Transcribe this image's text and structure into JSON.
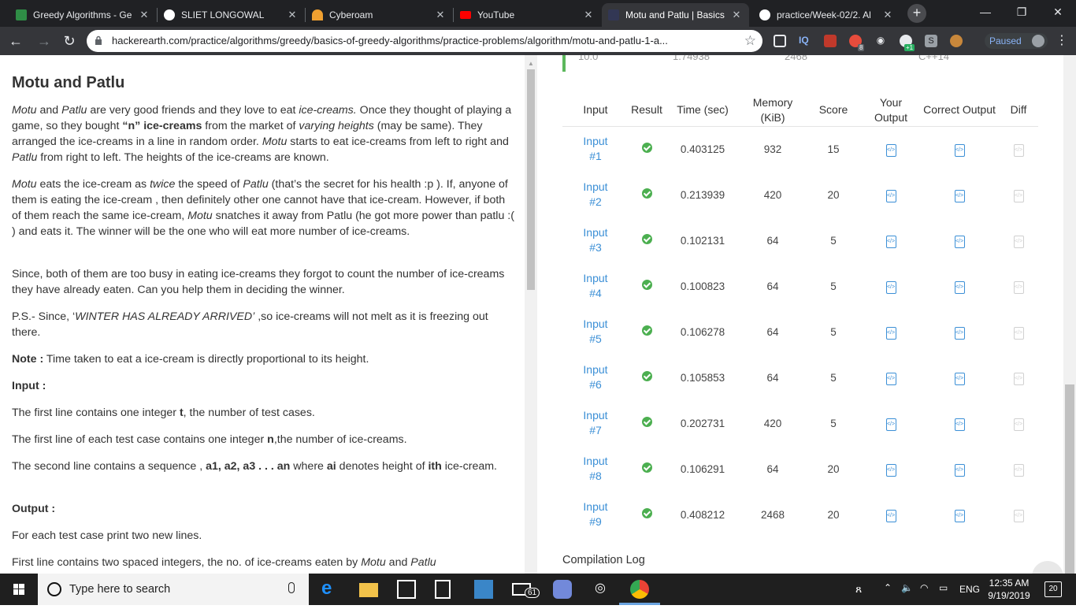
{
  "browser": {
    "tabs": [
      {
        "title": "Greedy Algorithms - Ge",
        "active": false
      },
      {
        "title": "SLIET LONGOWAL",
        "active": false
      },
      {
        "title": "Cyberoam",
        "active": false
      },
      {
        "title": "YouTube",
        "active": false
      },
      {
        "title": "Motu and Patlu | Basics",
        "active": true
      },
      {
        "title": "practice/Week-02/2. Al",
        "active": false
      }
    ],
    "url": "hackerearth.com/practice/algorithms/greedy/basics-of-greedy-algorithms/practice-problems/algorithm/motu-and-patlu-1-a...",
    "profile_status": "Paused",
    "extension_badges": {
      "red_badge": "8",
      "green_badge": "+1"
    }
  },
  "problem": {
    "title": "Motu and Patlu",
    "paragraphs": {
      "p1": [
        "Motu",
        " and ",
        "Patlu",
        " are very good friends and they love to eat ",
        "ice-creams.",
        " Once they thought of playing a game, so they bought ",
        "“n” ice-creams",
        " from the market of ",
        "varying heights",
        " (may be same). They arranged the ice-creams in a line in random order. ",
        "Motu",
        " starts to eat ice-creams from left to right and ",
        "Patlu",
        " from right to left. The heights of the ice-creams are known."
      ],
      "p2": [
        "Motu",
        " eats the ice-cream as ",
        "twice",
        " the speed of ",
        "Patlu",
        " (that’s the secret for his health :p ). If, anyone of them is eating the ice-cream , then definitely other one cannot have that ice-cream. However, if both of them reach the same ice-cream, ",
        "Motu",
        " snatches it away from Patlu (he got more power than patlu :( ) and eats it. The winner will be the one who will eat more number of ice-creams."
      ],
      "p3": "Since, both of them are too busy in eating ice-creams they forgot to count the number of ice-creams they have already eaten. Can you help them in deciding the winner.",
      "p4": [
        "P.S.- Since, ‘",
        "WINTER HAS ALREADY ARRIVED’",
        " ,so ice-creams will not melt as it is freezing out there."
      ],
      "note_label": "Note :",
      "note_text": " Time taken to eat a ice-cream is directly proportional to its height.",
      "input_heading": "Input :",
      "input1": [
        "The first line contains one integer ",
        "t",
        ", the number of test cases."
      ],
      "input2": [
        "The first line of each test case contains one integer ",
        "n",
        ",the number of ice-creams."
      ],
      "input3": [
        "The second line contains a sequence , ",
        "a1, a2, a3 . . . an",
        " where ",
        "ai",
        " denotes height of ",
        "ith",
        " ice-cream."
      ],
      "output_heading": "Output :",
      "output1": "For each test case print two new lines.",
      "output2": [
        "First line contains two spaced integers, the no. of ice-creams eaten by ",
        "Motu",
        " and ",
        "Patlu"
      ]
    }
  },
  "results": {
    "prev_row_partial": [
      "10.0",
      "1.74938",
      "2468",
      "C++14"
    ],
    "headers": {
      "input": "Input",
      "result": "Result",
      "time": "Time (sec)",
      "memory": "Memory (KiB)",
      "score": "Score",
      "your_output": "Your Output",
      "correct_output": "Correct Output",
      "diff": "Diff"
    },
    "rows": [
      {
        "input": "Input #1",
        "time": "0.403125",
        "memory": "932",
        "score": "15"
      },
      {
        "input": "Input #2",
        "time": "0.213939",
        "memory": "420",
        "score": "20"
      },
      {
        "input": "Input #3",
        "time": "0.102131",
        "memory": "64",
        "score": "5"
      },
      {
        "input": "Input #4",
        "time": "0.100823",
        "memory": "64",
        "score": "5"
      },
      {
        "input": "Input #5",
        "time": "0.106278",
        "memory": "64",
        "score": "5"
      },
      {
        "input": "Input #6",
        "time": "0.105853",
        "memory": "64",
        "score": "5"
      },
      {
        "input": "Input #7",
        "time": "0.202731",
        "memory": "420",
        "score": "5"
      },
      {
        "input": "Input #8",
        "time": "0.106291",
        "memory": "64",
        "score": "20"
      },
      {
        "input": "Input #9",
        "time": "0.408212",
        "memory": "2468",
        "score": "20"
      }
    ],
    "compilation_log": "Compilation Log"
  },
  "taskbar": {
    "search_placeholder": "Type here to search",
    "mail_badge": "61",
    "language": "ENG",
    "time": "12:35 AM",
    "date": "9/19/2019",
    "notifications": "20"
  },
  "colors": {
    "accent_link": "#3b8fd6",
    "success": "#4caf50",
    "chrome_dark": "#202124"
  }
}
